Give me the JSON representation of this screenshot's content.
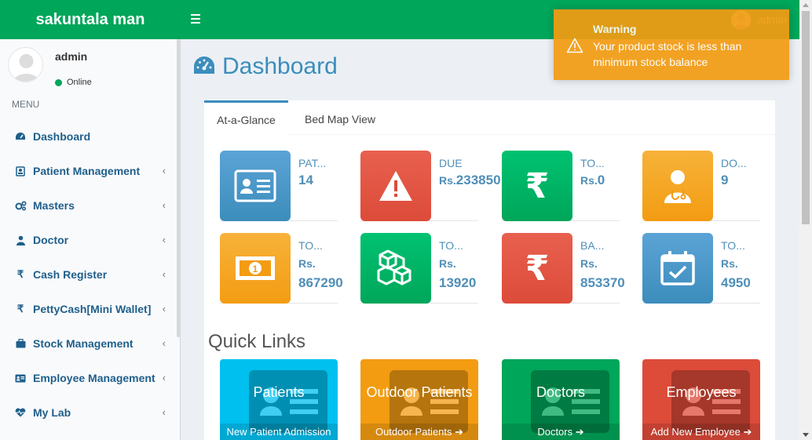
{
  "header": {
    "brand": "sakuntala man",
    "user_name": "admin"
  },
  "sidebar": {
    "user": {
      "name": "admin",
      "status": "Online"
    },
    "menu_header": "MENU",
    "items": [
      {
        "label": "Dashboard",
        "icon": "dashboard-icon",
        "has_submenu": false
      },
      {
        "label": "Patient Management",
        "icon": "id-card-icon",
        "has_submenu": true
      },
      {
        "label": "Masters",
        "icon": "gears-icon",
        "has_submenu": true
      },
      {
        "label": "Doctor",
        "icon": "user-md-icon",
        "has_submenu": true
      },
      {
        "label": "Cash Register",
        "icon": "rupee-icon",
        "has_submenu": true
      },
      {
        "label": "PettyCash[Mini Wallet]",
        "icon": "rupee-icon",
        "has_submenu": true
      },
      {
        "label": "Stock Management",
        "icon": "briefcase-icon",
        "has_submenu": true
      },
      {
        "label": "Employee Management",
        "icon": "address-card-icon",
        "has_submenu": true
      },
      {
        "label": "My Lab",
        "icon": "heartbeat-icon",
        "has_submenu": true
      }
    ]
  },
  "page": {
    "title": "Dashboard"
  },
  "tabs": [
    {
      "label": "At-a-Glance",
      "active": true
    },
    {
      "label": "Bed Map View",
      "active": false
    }
  ],
  "info_boxes": [
    {
      "label": "PAT...",
      "value": "14",
      "color": "#3c8dbc",
      "icon": "id-card-icon"
    },
    {
      "label": "DUE",
      "prefix": "Rs.",
      "value": "233850",
      "color": "#dd4b39",
      "icon": "warning-icon"
    },
    {
      "label": "TO...",
      "prefix": "Rs.",
      "value": "0",
      "color": "#00a65a",
      "icon": "rupee-icon"
    },
    {
      "label": "DO...",
      "value": "9",
      "color": "#f39c12",
      "icon": "user-md-icon"
    },
    {
      "label": "TO...",
      "prefix": "Rs.",
      "value": "867290",
      "color": "#f39c12",
      "icon": "money-icon"
    },
    {
      "label": "TO...",
      "prefix": "Rs.",
      "value": "13920",
      "color": "#00a65a",
      "icon": "cubes-icon"
    },
    {
      "label": "BA...",
      "prefix": "Rs.",
      "value": "853370",
      "color": "#dd4b39",
      "icon": "rupee-icon"
    },
    {
      "label": "TO...",
      "prefix": "Rs.",
      "value": "4950",
      "color": "#3c8dbc",
      "icon": "calendar-check-icon"
    }
  ],
  "quick_links": {
    "title": "Quick Links",
    "items": [
      {
        "title": "Patients",
        "footer": "New Patient Admission",
        "color": "#00c0ef"
      },
      {
        "title": "Outdoor Patients",
        "footer": "Outdoor Patients",
        "color": "#f39c12"
      },
      {
        "title": "Doctors",
        "footer": "Doctors",
        "color": "#00a65a"
      },
      {
        "title": "Employees",
        "footer": "Add New Employee",
        "color": "#dd4b39"
      }
    ]
  },
  "toast": {
    "title": "Warning",
    "message": "Your product stock is less than minimum stock balance",
    "color": "#f39c12"
  }
}
